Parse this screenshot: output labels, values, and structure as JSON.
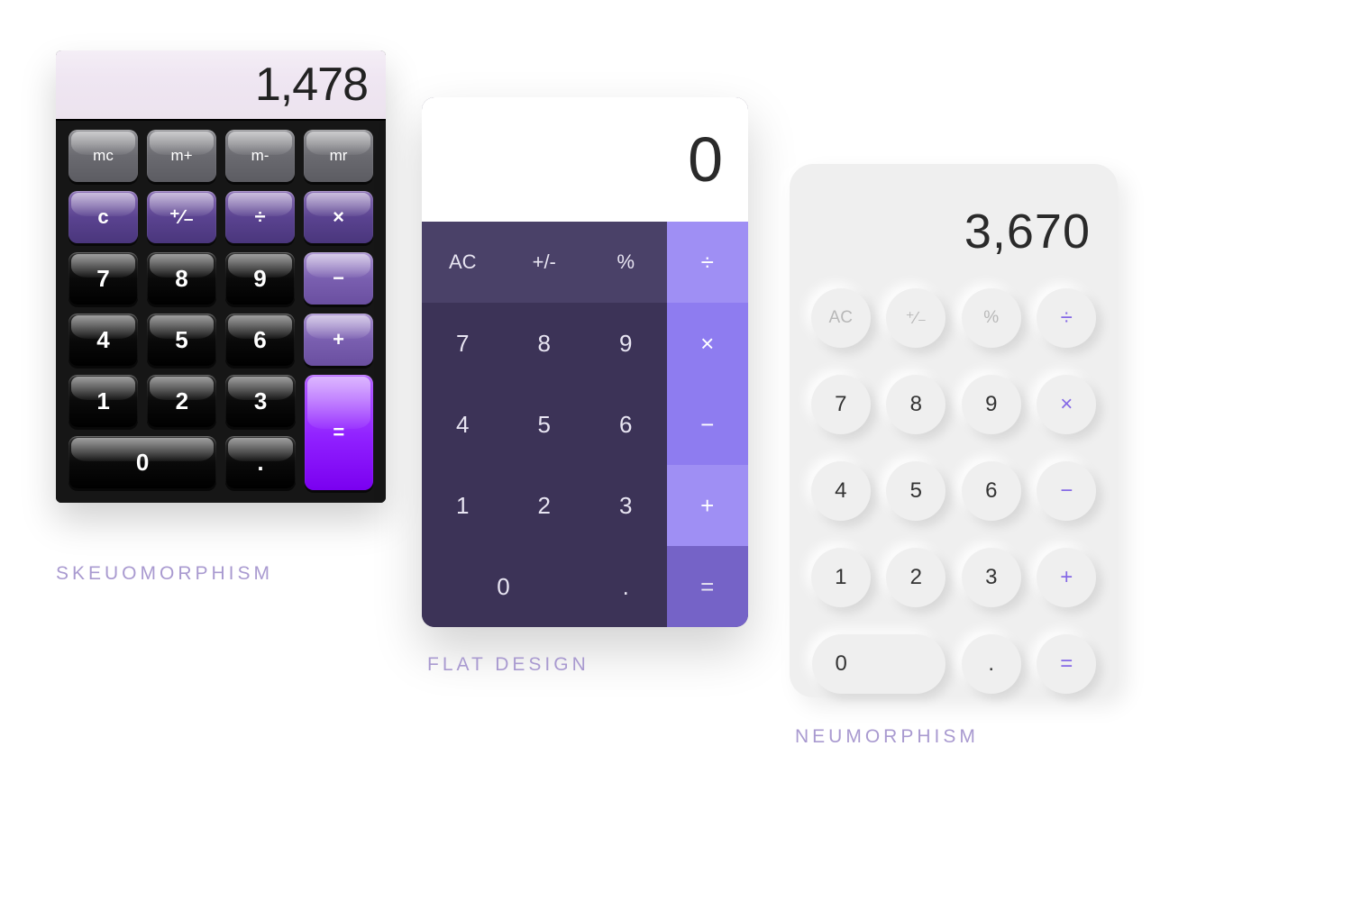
{
  "skeu": {
    "label": "SKEUOMORPHISM",
    "display": "1,478",
    "mem": [
      "mc",
      "m+",
      "m-",
      "mr"
    ],
    "funcs": {
      "clear": "c",
      "sign": "⁺∕₋",
      "div": "÷",
      "mul": "×"
    },
    "digits": {
      "d7": "7",
      "d8": "8",
      "d9": "9",
      "d4": "4",
      "d5": "5",
      "d6": "6",
      "d1": "1",
      "d2": "2",
      "d3": "3",
      "d0": "0"
    },
    "ops": {
      "minus": "−",
      "plus": "+",
      "dot": ".",
      "eq": "="
    }
  },
  "flat": {
    "label": "FLAT DESIGN",
    "display": "0",
    "funcs": {
      "ac": "AC",
      "sign": "+/-",
      "pct": "%"
    },
    "ops": {
      "div": "÷",
      "mul": "×",
      "minus": "−",
      "plus": "+",
      "eq": "="
    },
    "digits": {
      "d7": "7",
      "d8": "8",
      "d9": "9",
      "d4": "4",
      "d5": "5",
      "d6": "6",
      "d1": "1",
      "d2": "2",
      "d3": "3",
      "d0": "0",
      "dot": "."
    }
  },
  "neu": {
    "label": "NEUMORPHISM",
    "display": "3,670",
    "funcs": {
      "ac": "AC",
      "sign": "⁺∕₋",
      "pct": "%"
    },
    "ops": {
      "div": "÷",
      "mul": "×",
      "minus": "−",
      "plus": "+",
      "eq": "="
    },
    "digits": {
      "d7": "7",
      "d8": "8",
      "d9": "9",
      "d4": "4",
      "d5": "5",
      "d6": "6",
      "d1": "1",
      "d2": "2",
      "d3": "3",
      "d0": "0",
      "dot": "."
    }
  }
}
